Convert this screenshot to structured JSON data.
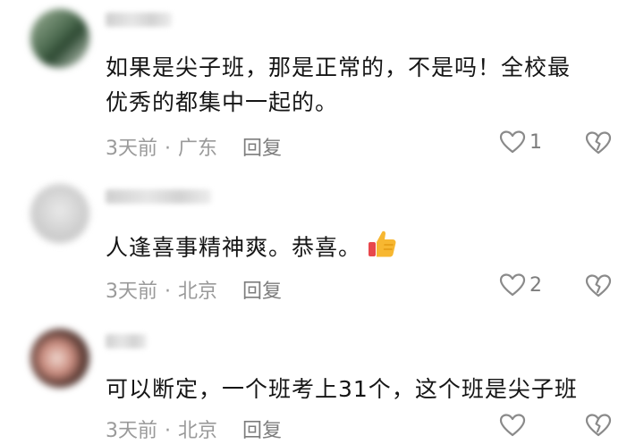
{
  "comments": [
    {
      "content_lines": [
        "如果是尖子班，那是正常的，不是吗！全校最",
        "优秀的都集中一起的。"
      ],
      "time": "3天前",
      "separator": "·",
      "location": "广东",
      "reply_label": "回复",
      "likes": "1",
      "emoji": ""
    },
    {
      "content_lines": [
        "人逢喜事精神爽。恭喜。"
      ],
      "time": "3天前",
      "separator": "·",
      "location": "北京",
      "reply_label": "回复",
      "likes": "2",
      "emoji": "thumbs-up"
    },
    {
      "content_lines": [
        "可以断定，一个班考上31个，这个班是尖子班"
      ],
      "time": "3天前",
      "separator": "·",
      "location": "北京",
      "reply_label": "回复",
      "likes": "",
      "emoji": ""
    }
  ],
  "icons": {
    "like": "heart-outline-icon",
    "dislike": "broken-heart-icon"
  },
  "colors": {
    "text": "#151515",
    "meta": "#9a9a9a",
    "icon": "#8a8a8a"
  }
}
